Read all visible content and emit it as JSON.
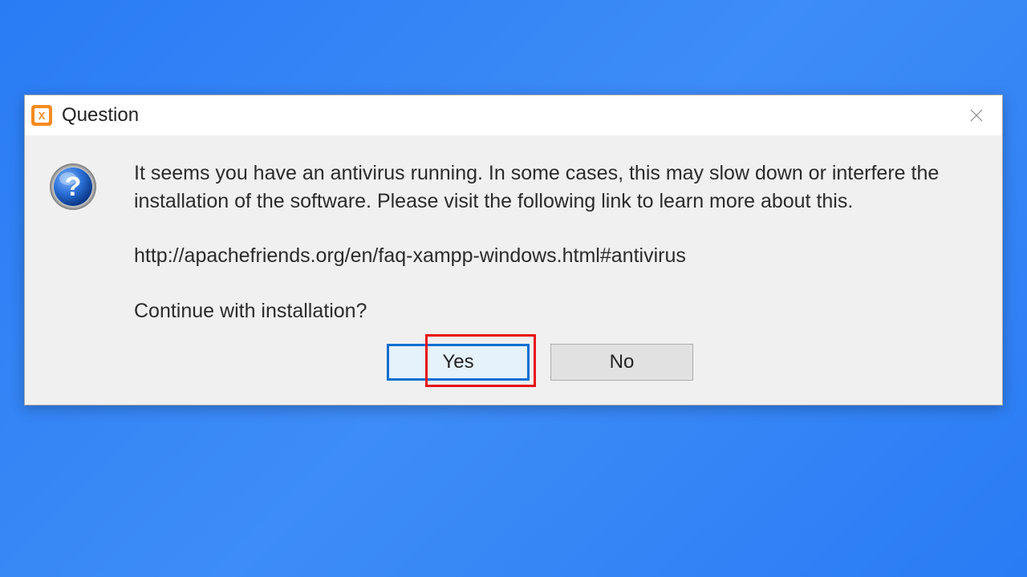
{
  "dialog": {
    "title": "Question",
    "message": "It seems you have an antivirus running. In some cases, this may slow down or interfere the installation of the software. Please visit the following link to learn more about this.",
    "link": "http://apachefriends.org/en/faq-xampp-windows.html#antivirus",
    "prompt": "Continue with installation?",
    "buttons": {
      "yes": "Yes",
      "no": "No"
    }
  }
}
